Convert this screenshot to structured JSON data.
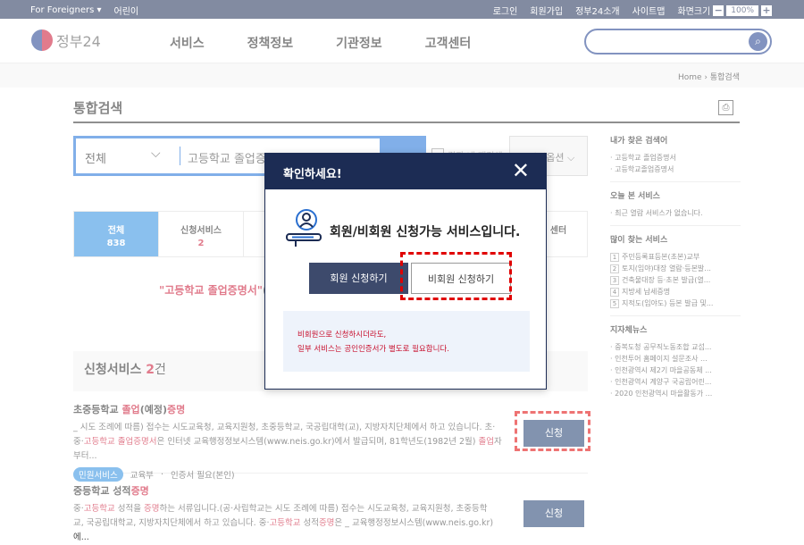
{
  "topbar": {
    "lang": "For Foreigners",
    "kids": "어린이",
    "links": [
      "로그인",
      "회원가입",
      "정부24소개",
      "사이트맵"
    ],
    "zoom_label": "화면크기",
    "zoom_minus": "−",
    "zoom_value": "100%",
    "zoom_plus": "+"
  },
  "header": {
    "logo_text": "정부24",
    "nav": [
      "서비스",
      "정책정보",
      "기관정보",
      "고객센터"
    ],
    "search_placeholder": ""
  },
  "breadcrumb": {
    "home": "Home",
    "sep": "›",
    "current": "통합검색"
  },
  "page": {
    "title": "통합검색"
  },
  "search": {
    "category": "전체",
    "query": "고등학교 졸업증명서",
    "checkbox_label": "결과 내 재검색",
    "option_label": "검색옵션"
  },
  "tabs": [
    {
      "label": "전체",
      "count": "838"
    },
    {
      "label": "신청서비스",
      "count": "2"
    },
    {
      "label": "센터",
      "count": ""
    }
  ],
  "notice": {
    "query": "\"고등학교 졸업증명서\"",
    "rest": "("
  },
  "section": {
    "title": "신청서비스",
    "count": "2",
    "unit": "건"
  },
  "results": [
    {
      "title_pre": "초중등학교 ",
      "title_hl": "졸업",
      "title_mid": "(예정)",
      "title_hl2": "증명",
      "line1": "_ 시도 조례에 따름) 접수는 시도교육청, 교육지원청, 초중등학교, 국공립대학(교), 지방자치단체에서 하고 있습니다. 초·",
      "line2_pre": "중·",
      "line2_hl": "고등학교 졸업증명서",
      "line2_mid": "은 인터넷 교육행정정보시스템(www.neis.go.kr)에서 발급되며, 81학년도(1982년 2월) ",
      "line2_hl2": "졸업",
      "line2_end": "자부터...",
      "badge": "민원서비스",
      "org": "교육부",
      "note": "인증서 필요(본인)",
      "button": "신청"
    },
    {
      "title_pre": "중등학교 성적",
      "title_hl": "증명",
      "line1_pre": "중·",
      "line1_hl": "고등학교",
      "line1_mid": " 성적을 ",
      "line1_hl2": "증명",
      "line1_end": "하는 서류입니다.(공·사립학교는 시도 조례에 따름) 접수는 시도교육청, 교육지원청, 초중등학",
      "line2_pre": "교, 국공립대학교, 지방자치단체에서 하고 있습니다. 중·",
      "line2_hl": "고등학교",
      "line2_mid": " 성적",
      "line2_hl2": "증명",
      "line2_end": "은 _ 교육행정정보시스템(www.neis.go.kr)에...",
      "button": "신청"
    }
  ],
  "sidebar": {
    "recent_search_title": "내가 찾은 검색어",
    "recent_search": [
      "· 고등학교 졸업증명서",
      "· 고등학교졸업증명서"
    ],
    "today_title": "오늘 본 서비스",
    "today": [
      "· 최근 열람 서비스가 없습니다."
    ],
    "popular_title": "많이 찾는 서비스",
    "popular": [
      {
        "n": "1",
        "t": "주민등록표등본(초본)교부"
      },
      {
        "n": "2",
        "t": "토지(임야)대장 열람·등본발..."
      },
      {
        "n": "3",
        "t": "건축물대장 등·초본 발급(열..."
      },
      {
        "n": "4",
        "t": "지방세 납세증명"
      },
      {
        "n": "5",
        "t": "지적도(임야도) 등본 발급 및..."
      }
    ],
    "news_title": "지자체뉴스",
    "news": [
      "· 중복도청 공무직노동조합 교섭...",
      "· 인천투어 홈페이지 설문조사 ...",
      "· 인천광역시 제2기 마을공동체 ...",
      "· 인천광역시 계양구 국공립어린...",
      "· 2020 인천광역시 마을활동가 ..."
    ]
  },
  "modal": {
    "title": "확인하세요!",
    "close": "✕",
    "message": "회원/비회원 신청가능 서비스입니다.",
    "member_button": "회원 신청하기",
    "nonmember_button": "비회원 신청하기",
    "info_line1": "비회원으로 신청하시더라도,",
    "info_line2": "일부 서비스는 공인인증서가 별도로 필요합니다."
  },
  "colors": {
    "navy": "#1c2c54",
    "blue": "#1a6dd8",
    "red": "#c8102e",
    "highlight_box": "#e00000"
  }
}
